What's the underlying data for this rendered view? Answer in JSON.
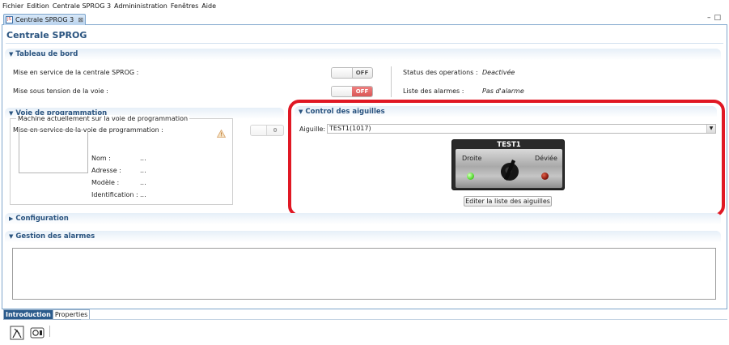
{
  "menu": [
    "Fichier",
    "Edition",
    "Centrale SPROG 3",
    "Admininistration",
    "Fenêtres",
    "Aide"
  ],
  "tab": {
    "label": "Centrale SPROG 3",
    "close": "⊠"
  },
  "window_controls": "□",
  "page_title": "Centrale SPROG",
  "tableau": {
    "header": "Tableau de bord",
    "mise_service_label": "Mise en service de la centrale SPROG :",
    "mise_service_state": "OFF",
    "mise_tension_label": "Mise sous tension de la voie :",
    "mise_tension_state": "OFF",
    "status_label": "Status des operations :",
    "status_value": "Deactivée",
    "alarmes_label": "Liste des alarmes :",
    "alarmes_value": "Pas d'alarme"
  },
  "voie": {
    "header": "Voie de programmation",
    "mise_service_label": "Mise en service de la voie de programmation :",
    "mise_service_state": "0",
    "machine_legend": "Machine actuellement sur la voie de programmation",
    "fields": [
      {
        "key": "Nom :",
        "value": "..."
      },
      {
        "key": "Adresse :",
        "value": "..."
      },
      {
        "key": "Modèle :",
        "value": "..."
      },
      {
        "key": "Identification :",
        "value": "..."
      }
    ]
  },
  "control": {
    "header": "Control des aiguilles",
    "aiguille_label": "Aiguille:",
    "aiguille_value": "TEST1(1017)",
    "switch_title": "TEST1",
    "droite_label": "Droite",
    "deviee_label": "Déviée",
    "droite_led_color": "#5fe03a",
    "deviee_led_color": "#8a1a10",
    "edit_button": "Editer la liste des aiguilles"
  },
  "configuration": {
    "header": "Configuration"
  },
  "gestion_alarmes": {
    "header": "Gestion des alarmes"
  },
  "bottom_tabs": {
    "introduction": "Introduction",
    "properties": "Properties"
  },
  "colors": {
    "section_text": "#29537f",
    "highlight": "#e01824",
    "active_tab": "#2b5b8c"
  }
}
